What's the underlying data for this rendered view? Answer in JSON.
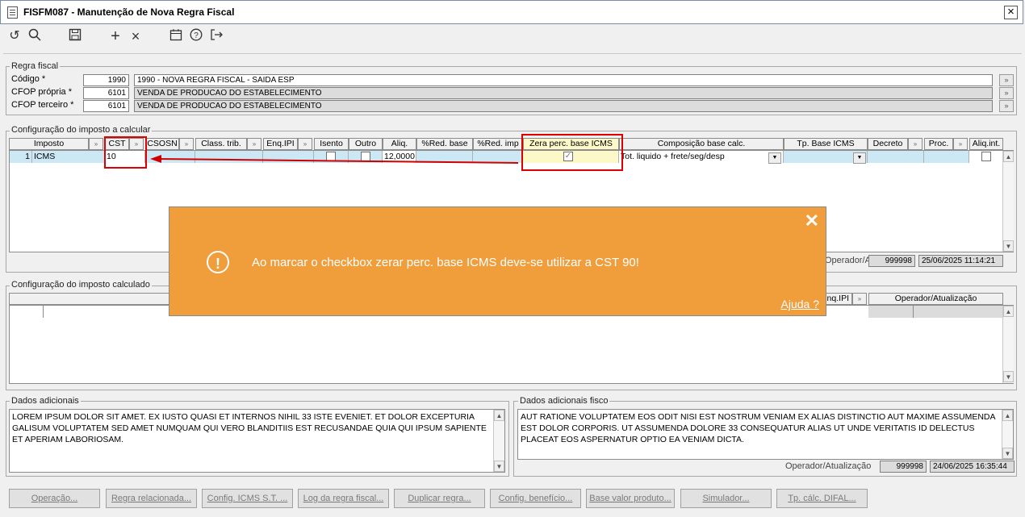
{
  "window": {
    "title": "FISFM087 - Manutenção de Nova Regra Fiscal"
  },
  "regra": {
    "legend": "Regra fiscal",
    "codigo_label": "Código *",
    "codigo_num": "1990",
    "codigo_desc": "1990 - NOVA REGRA FISCAL - SAIDA ESP",
    "cfop_propria_label": "CFOP própria *",
    "cfop_propria_num": "6101",
    "cfop_propria_desc": "VENDA DE PRODUCAO DO ESTABELECIMENTO",
    "cfop_terceiro_label": "CFOP terceiro *",
    "cfop_terceiro_num": "6101",
    "cfop_terceiro_desc": "VENDA DE PRODUCAO DO ESTABELECIMENTO"
  },
  "config_calcular": {
    "legend": "Configuração do imposto a calcular",
    "headers": [
      "Imposto",
      "CST",
      "CSOSN",
      "Class. trib.",
      "Enq.IPI",
      "Isento",
      "Outro",
      "Aliq.",
      "%Red. base",
      "%Red. imp",
      "Zera perc. base ICMS",
      "Composição base calc.",
      "Tp. Base ICMS",
      "Decreto",
      "Proc.",
      "Aliq.int."
    ],
    "row": {
      "num": "1",
      "imposto": "ICMS",
      "cst": "10",
      "aliq": "12,0000",
      "composicao": "Tot. liquido + frete/seg/desp"
    },
    "atualizacao_label": "Operador/Atualização",
    "operador": "999998",
    "data": "25/06/2025 11:14:21"
  },
  "config_calculado": {
    "legend": "Configuração do imposto calculado",
    "headers": [
      "Enq.IPI",
      "Operador/Atualização"
    ]
  },
  "adicionais": {
    "legend": "Dados adicionais",
    "text": "LOREM IPSUM DOLOR SIT AMET. EX IUSTO QUASI ET INTERNOS NIHIL 33 ISTE EVENIET. ET DOLOR EXCEPTURIA GALISUM VOLUPTATEM SED AMET NUMQUAM QUI VERO BLANDITIIS EST RECUSANDAE QUIA QUI IPSUM SAPIENTE ET APERIAM LABORIOSAM."
  },
  "adicionais_fisco": {
    "legend": "Dados adicionais fisco",
    "text": "AUT RATIONE VOLUPTATEM EOS ODIT NISI EST NOSTRUM VENIAM EX ALIAS DISTINCTIO AUT MAXIME ASSUMENDA EST DOLOR CORPORIS. UT ASSUMENDA DOLORE 33 CONSEQUATUR ALIAS UT UNDE VERITATIS ID DELECTUS PLACEAT EOS ASPERNATUR OPTIO EA VENIAM DICTA.",
    "atualizacao_label": "Operador/Atualização",
    "operador": "999998",
    "data": "24/06/2025 16:35:44"
  },
  "buttons": [
    "Operação...",
    "Regra relacionada...",
    "Config. ICMS S.T. ...",
    "Log da regra fiscal...",
    "Duplicar regra...",
    "Config. benefício...",
    "Base valor produto...",
    "Simulador...",
    "Tp. cálc. DIFAL..."
  ],
  "toast": {
    "message": "Ao marcar o checkbox zerar perc. base ICMS deve-se utilizar a CST 90!",
    "help": "Ajuda ?",
    "close": "✕",
    "icon": "!"
  },
  "colors": {
    "toast": "#f09d3c",
    "highlight": "#d00000",
    "row_select": "#cce8f5"
  }
}
